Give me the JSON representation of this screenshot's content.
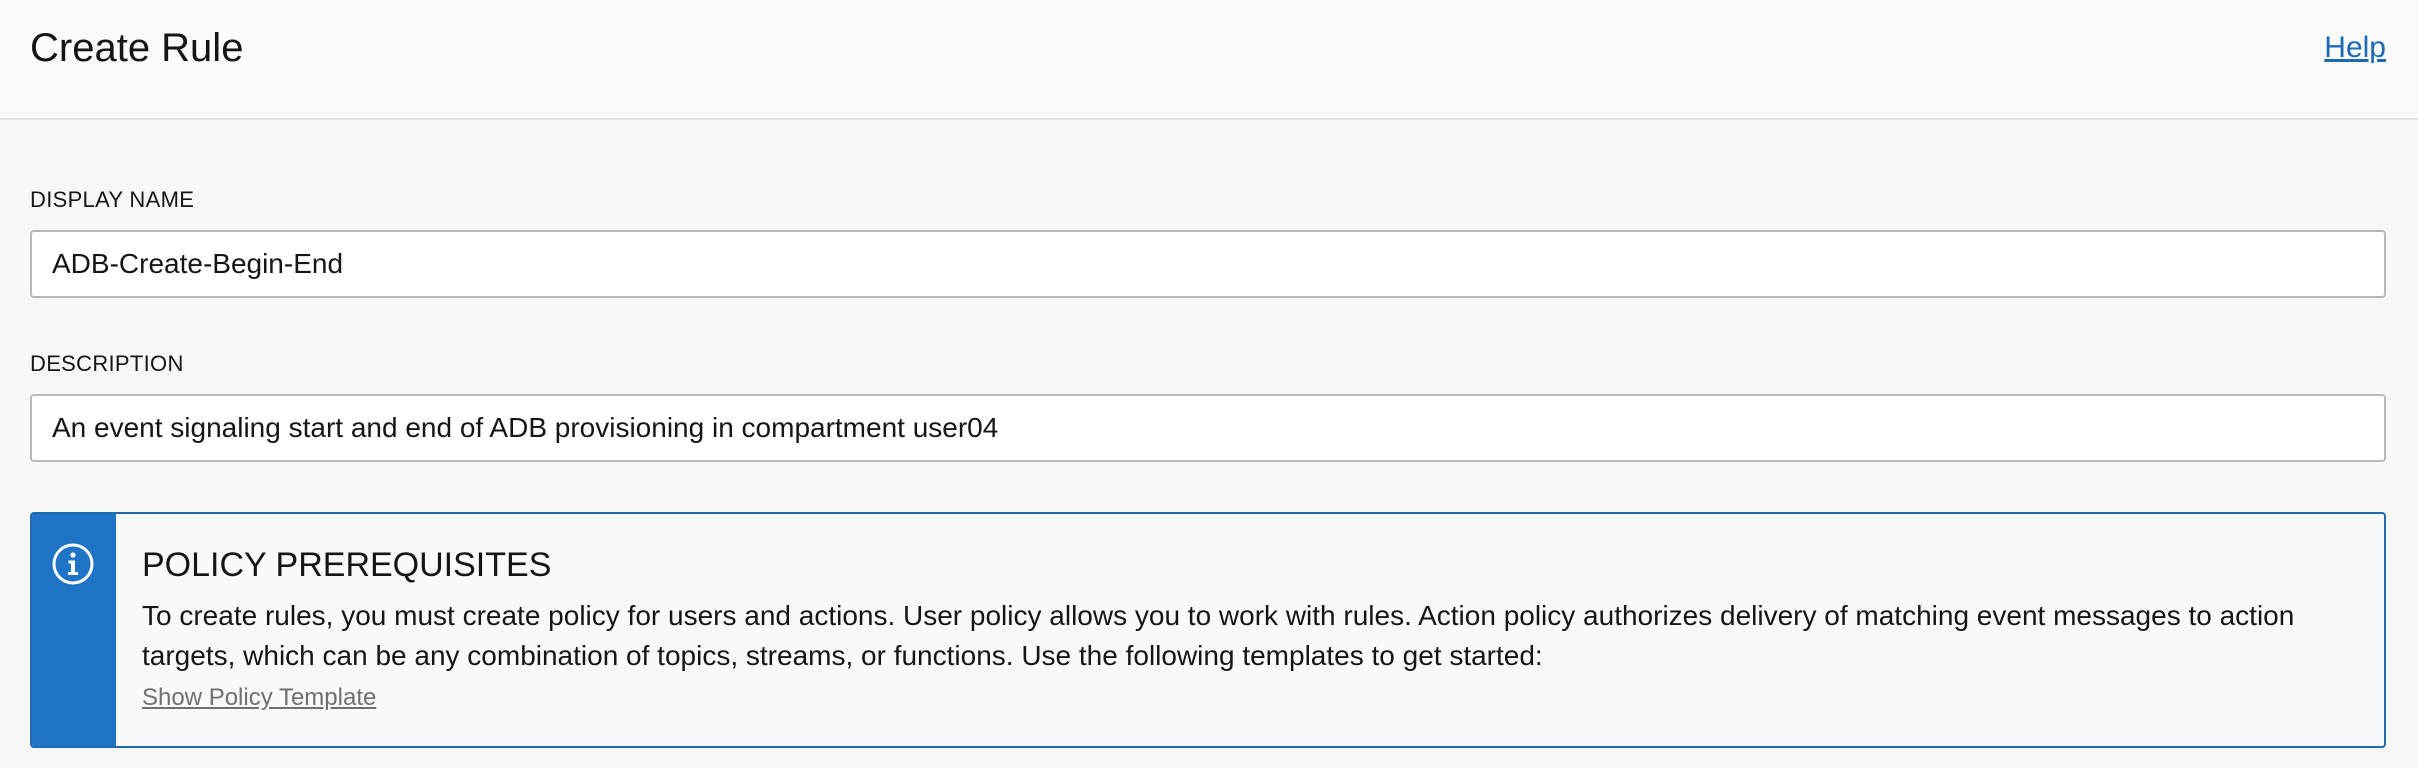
{
  "header": {
    "title": "Create Rule",
    "help_label": "Help"
  },
  "form": {
    "display_name": {
      "label": "DISPLAY NAME",
      "value": "ADB-Create-Begin-End"
    },
    "description": {
      "label": "DESCRIPTION",
      "value": "An event signaling start and end of ADB provisioning in compartment user04"
    }
  },
  "info_box": {
    "icon": "info-circle-icon",
    "title": "POLICY PREREQUISITES",
    "body": "To create rules, you must create policy for users and actions. User policy allows you to work with rules. Action policy authorizes delivery of matching event messages to action targets, which can be any combination of topics, streams, or functions. Use the following templates to get started:",
    "link_label": "Show Policy Template",
    "accent_color": "#1f74c6"
  },
  "colors": {
    "link": "#1d6ab3",
    "background": "#f7f7f7"
  }
}
